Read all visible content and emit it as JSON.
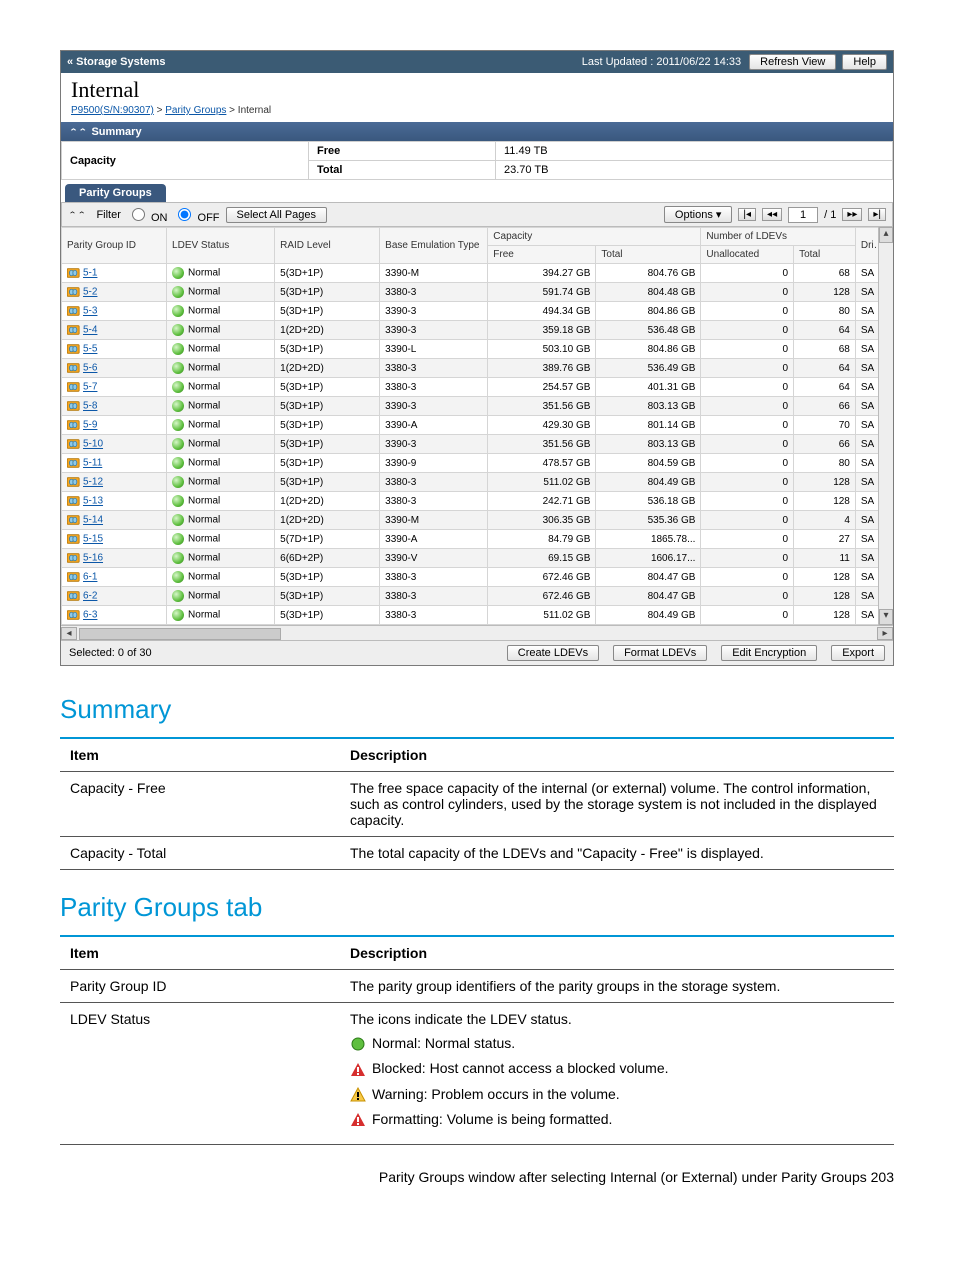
{
  "topbar": {
    "back": "« Storage Systems",
    "updated": "Last Updated : 2011/06/22 14:33",
    "refresh": "Refresh View",
    "help": "Help"
  },
  "title": "Internal",
  "breadcrumb": {
    "a": "P9500(S/N:90307)",
    "b": "Parity Groups",
    "c": "Internal"
  },
  "summary_hd": "Summary",
  "summary": {
    "capacity": "Capacity",
    "free_lbl": "Free",
    "free_val": "11.49 TB",
    "total_lbl": "Total",
    "total_val": "23.70 TB"
  },
  "tab": "Parity Groups",
  "toolbar": {
    "filter": "Filter",
    "on": "ON",
    "off": "OFF",
    "select_all": "Select All Pages",
    "options": "Options",
    "page": "1",
    "pages": "/ 1"
  },
  "headers": {
    "pg": "Parity Group ID",
    "ldev": "LDEV Status",
    "raid": "RAID Level",
    "emu": "Base Emulation Type",
    "cap": "Capacity",
    "free": "Free",
    "total": "Total",
    "nld": "Number of LDEVs",
    "unalloc": "Unallocated",
    "ntotal": "Total",
    "drive": "Drive Type"
  },
  "rows": [
    {
      "id": "5-1",
      "st": "Normal",
      "raid": "5(3D+1P)",
      "emu": "3390-M",
      "free": "394.27 GB",
      "total": "804.76 GB",
      "un": "0",
      "nt": "68",
      "dr": "SA"
    },
    {
      "id": "5-2",
      "st": "Normal",
      "raid": "5(3D+1P)",
      "emu": "3380-3",
      "free": "591.74 GB",
      "total": "804.48 GB",
      "un": "0",
      "nt": "128",
      "dr": "SA"
    },
    {
      "id": "5-3",
      "st": "Normal",
      "raid": "5(3D+1P)",
      "emu": "3390-3",
      "free": "494.34 GB",
      "total": "804.86 GB",
      "un": "0",
      "nt": "80",
      "dr": "SA"
    },
    {
      "id": "5-4",
      "st": "Normal",
      "raid": "1(2D+2D)",
      "emu": "3390-3",
      "free": "359.18 GB",
      "total": "536.48 GB",
      "un": "0",
      "nt": "64",
      "dr": "SA"
    },
    {
      "id": "5-5",
      "st": "Normal",
      "raid": "5(3D+1P)",
      "emu": "3390-L",
      "free": "503.10 GB",
      "total": "804.86 GB",
      "un": "0",
      "nt": "68",
      "dr": "SA"
    },
    {
      "id": "5-6",
      "st": "Normal",
      "raid": "1(2D+2D)",
      "emu": "3380-3",
      "free": "389.76 GB",
      "total": "536.49 GB",
      "un": "0",
      "nt": "64",
      "dr": "SA"
    },
    {
      "id": "5-7",
      "st": "Normal",
      "raid": "5(3D+1P)",
      "emu": "3380-3",
      "free": "254.57 GB",
      "total": "401.31 GB",
      "un": "0",
      "nt": "64",
      "dr": "SA"
    },
    {
      "id": "5-8",
      "st": "Normal",
      "raid": "5(3D+1P)",
      "emu": "3390-3",
      "free": "351.56 GB",
      "total": "803.13 GB",
      "un": "0",
      "nt": "66",
      "dr": "SA"
    },
    {
      "id": "5-9",
      "st": "Normal",
      "raid": "5(3D+1P)",
      "emu": "3390-A",
      "free": "429.30 GB",
      "total": "801.14 GB",
      "un": "0",
      "nt": "70",
      "dr": "SA"
    },
    {
      "id": "5-10",
      "st": "Normal",
      "raid": "5(3D+1P)",
      "emu": "3390-3",
      "free": "351.56 GB",
      "total": "803.13 GB",
      "un": "0",
      "nt": "66",
      "dr": "SA"
    },
    {
      "id": "5-11",
      "st": "Normal",
      "raid": "5(3D+1P)",
      "emu": "3390-9",
      "free": "478.57 GB",
      "total": "804.59 GB",
      "un": "0",
      "nt": "80",
      "dr": "SA"
    },
    {
      "id": "5-12",
      "st": "Normal",
      "raid": "5(3D+1P)",
      "emu": "3380-3",
      "free": "511.02 GB",
      "total": "804.49 GB",
      "un": "0",
      "nt": "128",
      "dr": "SA"
    },
    {
      "id": "5-13",
      "st": "Normal",
      "raid": "1(2D+2D)",
      "emu": "3380-3",
      "free": "242.71 GB",
      "total": "536.18 GB",
      "un": "0",
      "nt": "128",
      "dr": "SA"
    },
    {
      "id": "5-14",
      "st": "Normal",
      "raid": "1(2D+2D)",
      "emu": "3390-M",
      "free": "306.35 GB",
      "total": "535.36 GB",
      "un": "0",
      "nt": "4",
      "dr": "SA"
    },
    {
      "id": "5-15",
      "st": "Normal",
      "raid": "5(7D+1P)",
      "emu": "3390-A",
      "free": "84.79 GB",
      "total": "1865.78...",
      "un": "0",
      "nt": "27",
      "dr": "SA"
    },
    {
      "id": "5-16",
      "st": "Normal",
      "raid": "6(6D+2P)",
      "emu": "3390-V",
      "free": "69.15 GB",
      "total": "1606.17...",
      "un": "0",
      "nt": "11",
      "dr": "SA"
    },
    {
      "id": "6-1",
      "st": "Normal",
      "raid": "5(3D+1P)",
      "emu": "3380-3",
      "free": "672.46 GB",
      "total": "804.47 GB",
      "un": "0",
      "nt": "128",
      "dr": "SA"
    },
    {
      "id": "6-2",
      "st": "Normal",
      "raid": "5(3D+1P)",
      "emu": "3380-3",
      "free": "672.46 GB",
      "total": "804.47 GB",
      "un": "0",
      "nt": "128",
      "dr": "SA"
    },
    {
      "id": "6-3",
      "st": "Normal",
      "raid": "5(3D+1P)",
      "emu": "3380-3",
      "free": "511.02 GB",
      "total": "804.49 GB",
      "un": "0",
      "nt": "128",
      "dr": "SA"
    }
  ],
  "footer": {
    "selected": "Selected:  0    of  30",
    "create": "Create LDEVs",
    "format": "Format LDEVs",
    "edit": "Edit Encryption",
    "export": "Export"
  },
  "doc": {
    "sum_h": "Summary",
    "item": "Item",
    "desc": "Description",
    "sum_rows": [
      {
        "i": "Capacity - Free",
        "d": "The free space capacity of the internal (or external) volume. The control information, such as control cylinders, used by the storage system is not included in the displayed capacity."
      },
      {
        "i": "Capacity - Total",
        "d": "The total capacity of the LDEVs and \"Capacity - Free\" is displayed."
      }
    ],
    "pg_h": "Parity Groups tab",
    "pg_rows": {
      "r1i": "Parity Group ID",
      "r1d": "The parity group identifiers of the parity groups in the storage system.",
      "r2i": "LDEV Status",
      "r2d": "The icons indicate the LDEV status.",
      "st_normal": "Normal: Normal status.",
      "st_blocked": "Blocked: Host cannot access a blocked volume.",
      "st_warning": "Warning: Problem occurs in the volume.",
      "st_format": "Formatting: Volume is being formatted."
    },
    "footer": "Parity Groups window after selecting Internal (or External) under Parity Groups   203"
  }
}
